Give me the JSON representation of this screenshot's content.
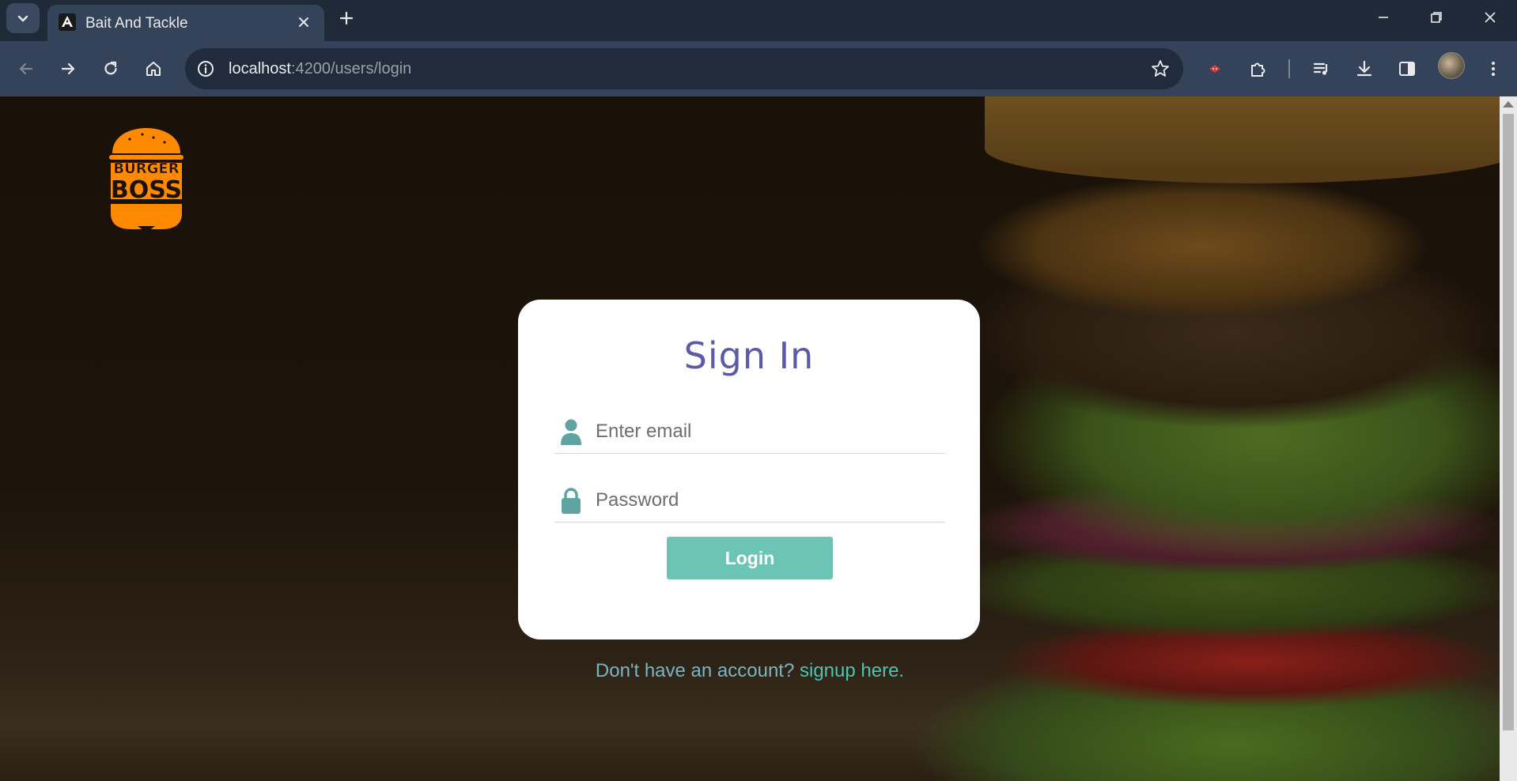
{
  "browser": {
    "tab_title": "Bait And Tackle",
    "url_host": "localhost",
    "url_path": ":4200/users/login"
  },
  "logo": {
    "line1": "BURGER",
    "line2": "BOSS",
    "color": "#ff8a00"
  },
  "login_card": {
    "title": "Sign In",
    "email_placeholder": "Enter email",
    "password_placeholder": "Password",
    "login_button": "Login",
    "accent_color": "#6cc5b4",
    "title_color": "#5b5aa6"
  },
  "signup": {
    "prompt": "Don't have an account?",
    "link_text": "signup here."
  }
}
